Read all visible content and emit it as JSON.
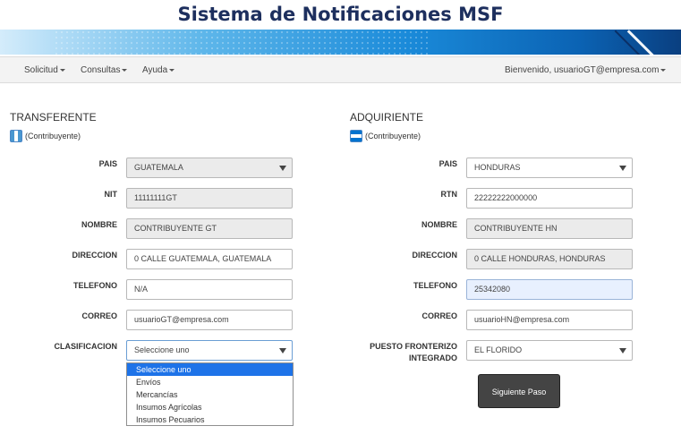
{
  "app_title": "Sistema de Notificaciones MSF",
  "nav": {
    "solicitud": "Solicitud",
    "consultas": "Consultas",
    "ayuda": "Ayuda",
    "user": "Bienvenido, usuarioGT@empresa.com"
  },
  "transferente": {
    "title": "TRANSFERENTE",
    "contrib": "(Contribuyente)",
    "pais_label": "PAIS",
    "pais": "GUATEMALA",
    "nit_label": "NIT",
    "nit": "11111111GT",
    "nombre_label": "NOMBRE",
    "nombre": "CONTRIBUYENTE GT",
    "direccion_label": "DIRECCION",
    "direccion": "0 CALLE GUATEMALA, GUATEMALA",
    "telefono_label": "TELEFONO",
    "telefono": "N/A",
    "correo_label": "CORREO",
    "correo": "usuarioGT@empresa.com",
    "clasificacion_label": "CLASIFICACION",
    "clasificacion": "Seleccione uno",
    "clasificacion_options": [
      "Seleccione uno",
      "Envíos",
      "Mercancías",
      "Insumos Agrícolas",
      "Insumos Pecuarios"
    ]
  },
  "adquiriente": {
    "title": "ADQUIRIENTE",
    "contrib": "(Contribuyente)",
    "pais_label": "PAIS",
    "pais": "HONDURAS",
    "rtn_label": "RTN",
    "rtn": "22222222000000",
    "nombre_label": "NOMBRE",
    "nombre": "CONTRIBUYENTE HN",
    "direccion_label": "DIRECCION",
    "direccion": "0 CALLE HONDURAS, HONDURAS",
    "telefono_label": "TELEFONO",
    "telefono": "25342080",
    "correo_label": "CORREO",
    "correo": "usuarioHN@empresa.com",
    "puesto_label_1": "PUESTO FRONTERIZO",
    "puesto_label_2": "INTEGRADO",
    "puesto": "EL FLORIDO"
  },
  "next_button": "Siguiente Paso"
}
